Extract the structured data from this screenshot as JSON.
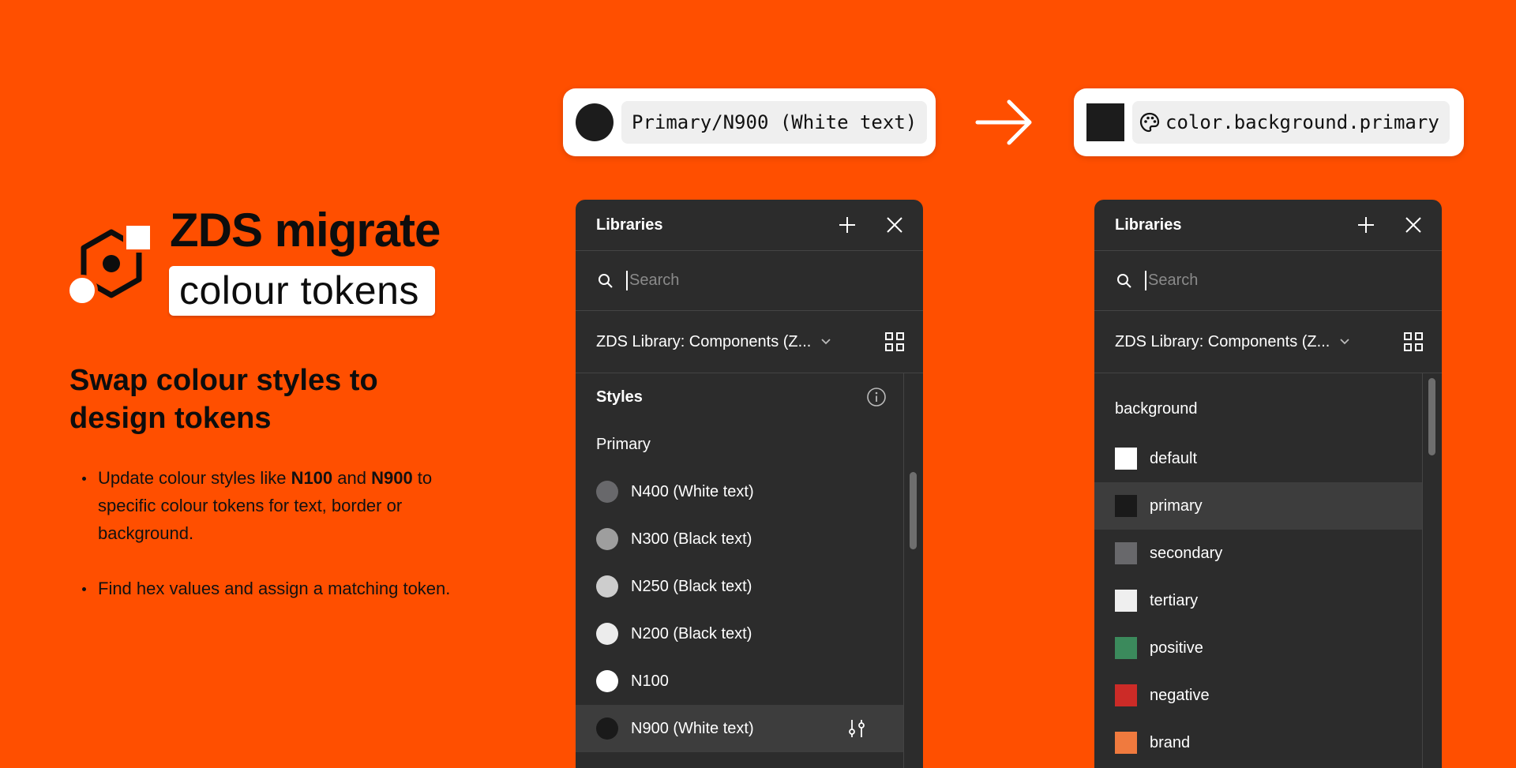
{
  "hero": {
    "title": "ZDS migrate",
    "subtitle": "colour tokens",
    "heading": "Swap colour styles to design tokens",
    "bullet1": {
      "pre": "Update colour styles like ",
      "b1": "N100",
      "mid": " and ",
      "b2": "N900",
      "post": " to specific colour tokens for text, border or background."
    },
    "bullet2": "Find hex values and assign a matching token."
  },
  "chips": {
    "from_label": "Primary/N900 (White text)",
    "to_label": "color.background.primary",
    "swatch_color": "#1c1c1c"
  },
  "left_panel": {
    "title": "Libraries",
    "search_placeholder": "Search",
    "library": "ZDS Library: Components (Z...",
    "section": "Styles",
    "group": "Primary",
    "items": [
      {
        "label": "N400 (White text)",
        "color": "#68686b"
      },
      {
        "label": "N300 (Black text)",
        "color": "#9e9e9e"
      },
      {
        "label": "N250 (Black text)",
        "color": "#cdcdcd"
      },
      {
        "label": "N200 (Black text)",
        "color": "#ececec"
      },
      {
        "label": "N100",
        "color": "#ffffff"
      },
      {
        "label": "N900 (White text)",
        "color": "#1a1a1a",
        "selected": true
      }
    ]
  },
  "right_panel": {
    "title": "Libraries",
    "search_placeholder": "Search",
    "library": "ZDS Library: Components (Z...",
    "group": "background",
    "items": [
      {
        "label": "default",
        "color": "#ffffff"
      },
      {
        "label": "primary",
        "color": "#1a1a1a",
        "selected": true
      },
      {
        "label": "secondary",
        "color": "#68686b"
      },
      {
        "label": "tertiary",
        "color": "#efefef"
      },
      {
        "label": "positive",
        "color": "#3b8a5c"
      },
      {
        "label": "negative",
        "color": "#cc2b27"
      },
      {
        "label": "brand",
        "color": "#f07a3e"
      }
    ]
  },
  "icons": [
    "hexagon-logo-icon",
    "arrow-right-icon",
    "palette-icon",
    "plus-icon",
    "close-icon",
    "search-icon",
    "chevron-down-icon",
    "grid-view-icon",
    "info-icon",
    "adjust-icon"
  ]
}
